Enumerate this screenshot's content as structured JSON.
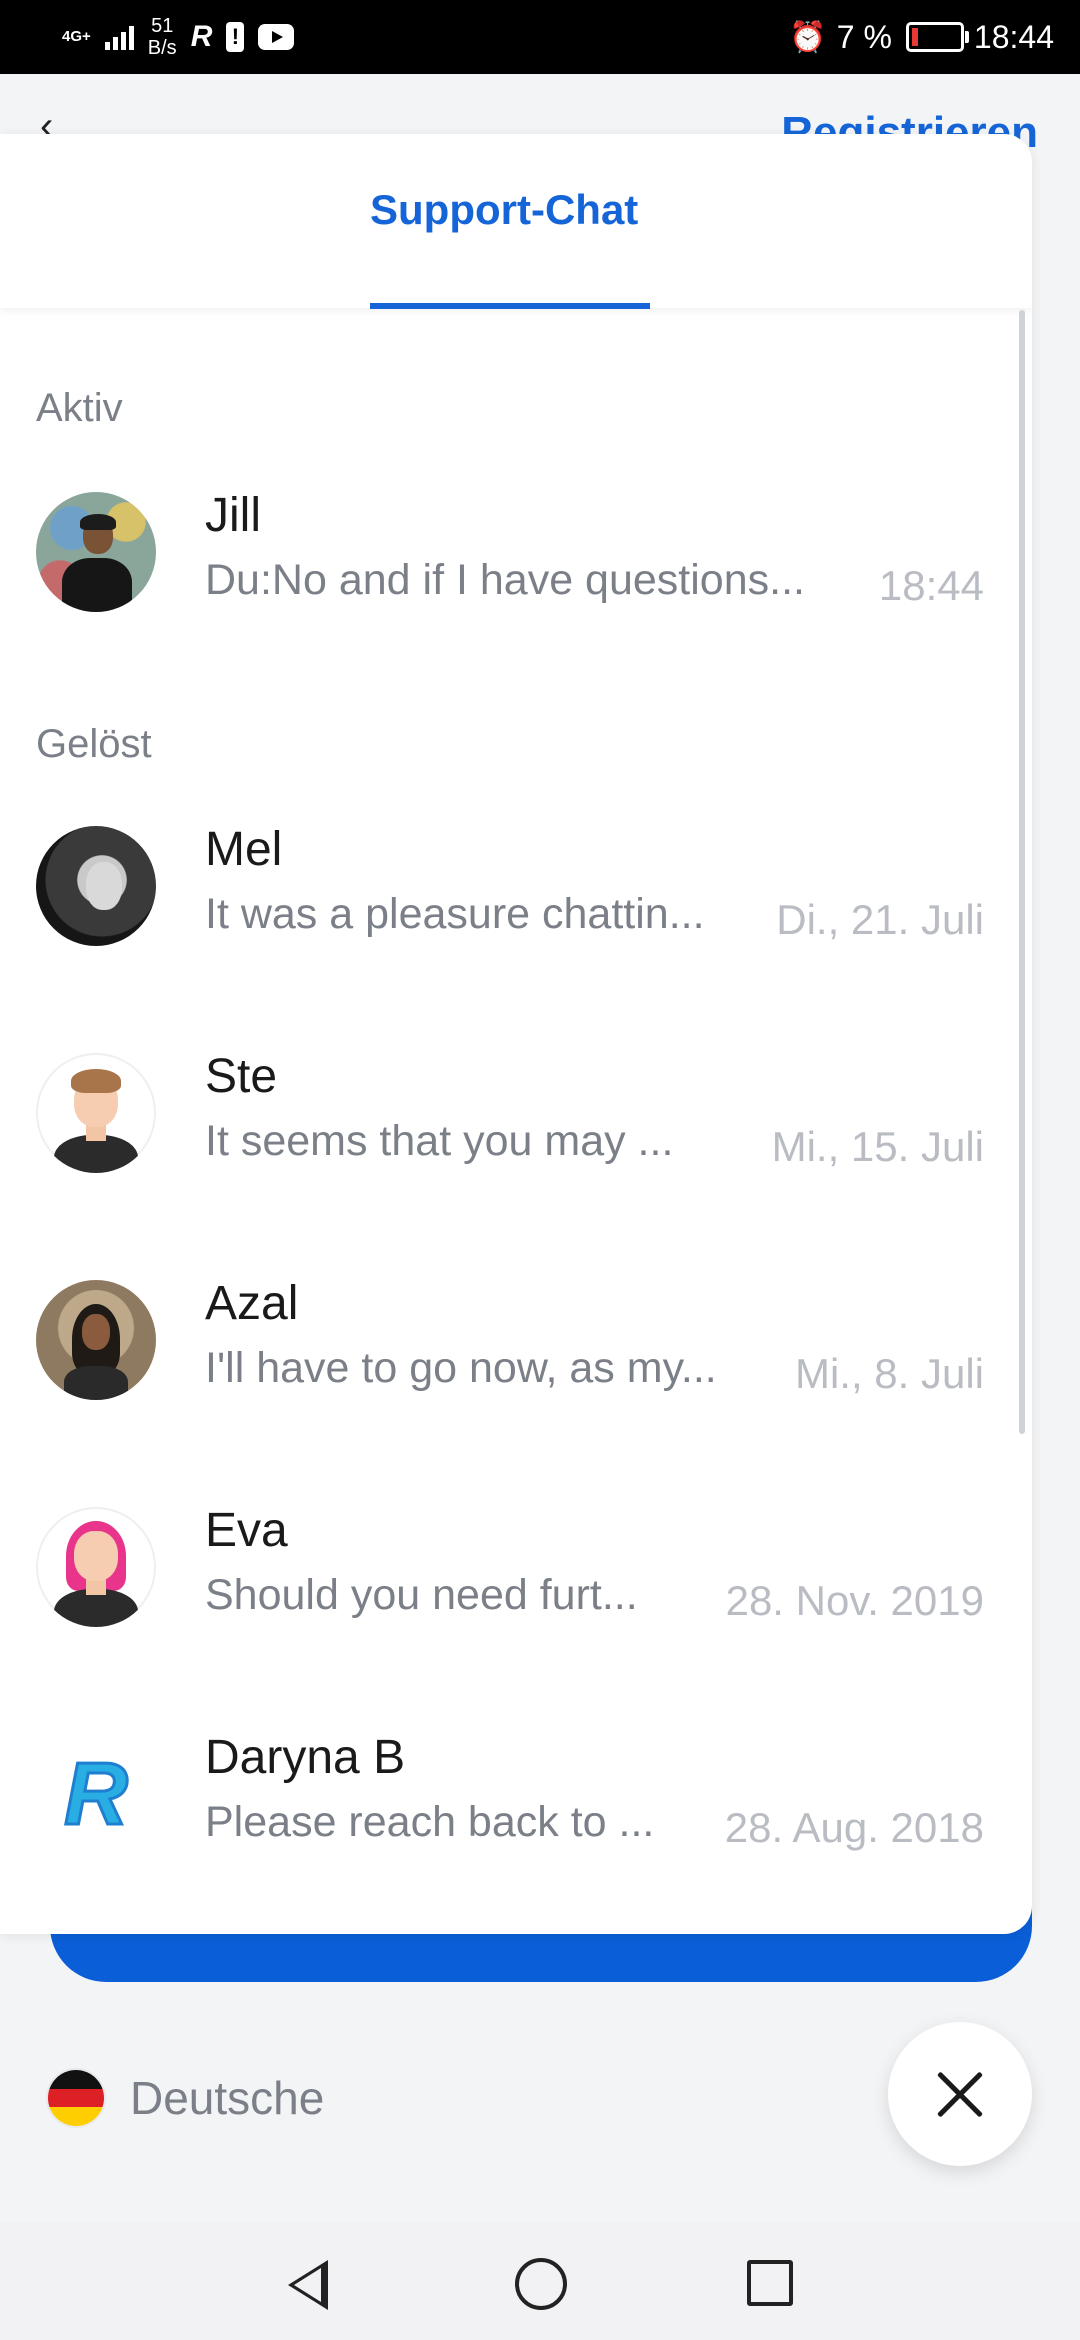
{
  "status_bar": {
    "network": "4G+",
    "speed_value": "51",
    "speed_unit": "B/s",
    "battery_percent": "7 %",
    "time": "18:44"
  },
  "background": {
    "register_label": "Registrieren",
    "language_label": "Deutsche"
  },
  "chat": {
    "tab_label": "Support-Chat",
    "sections": {
      "active_label": "Aktiv",
      "resolved_label": "Gelöst"
    },
    "items": [
      {
        "name": "Jill",
        "preview": "Du:No and if I have questions...",
        "time": "18:44"
      },
      {
        "name": "Mel",
        "preview": "It was a pleasure chattin...",
        "time": "Di., 21. Juli"
      },
      {
        "name": "Ste",
        "preview": "It seems that you may ...",
        "time": "Mi., 15. Juli"
      },
      {
        "name": "Azal",
        "preview": "I'll have to go now, as my...",
        "time": "Mi., 8. Juli"
      },
      {
        "name": "Eva",
        "preview": "Should you need furt...",
        "time": "28. Nov. 2019"
      },
      {
        "name": "Daryna B",
        "preview": "Please reach back to ...",
        "time": "28. Aug. 2018"
      }
    ]
  },
  "colors": {
    "accent": "#1565d8",
    "button_blue": "#0a5ed7",
    "text_muted": "#7b8088"
  }
}
